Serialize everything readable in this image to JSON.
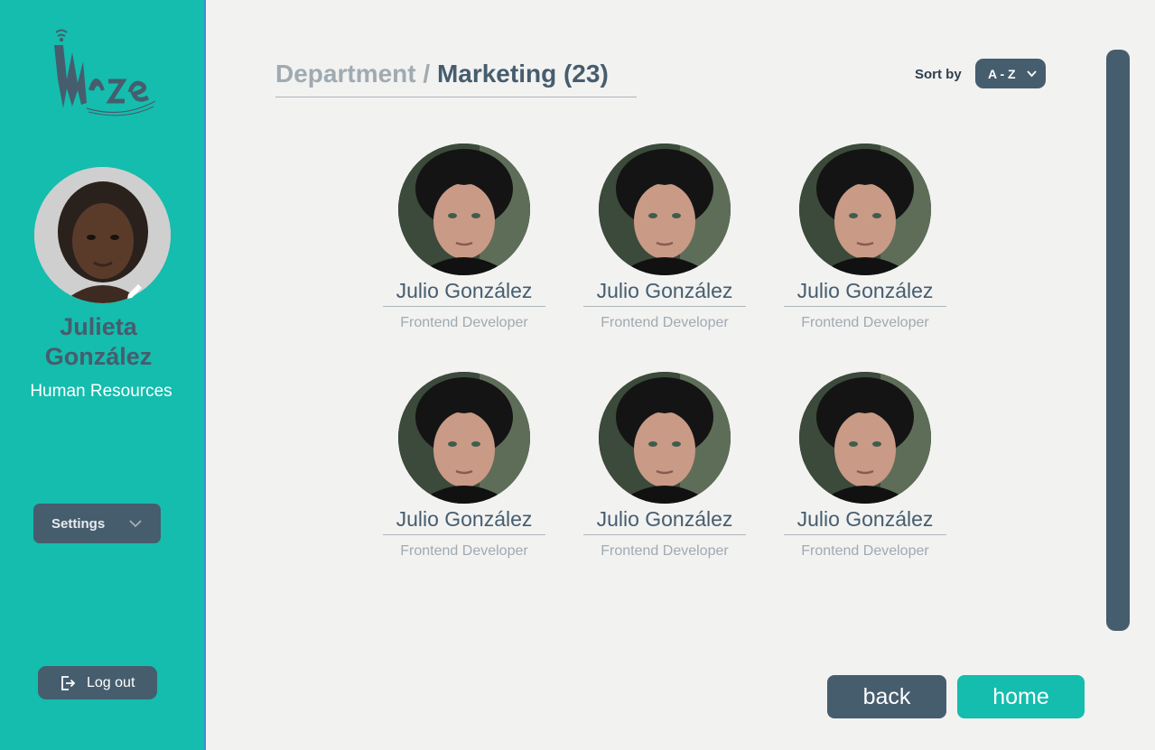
{
  "sidebar": {
    "user": {
      "first_name": "Julieta",
      "last_name": "González",
      "department": "Human Resources"
    },
    "settings_label": "Settings",
    "logout_label": "Log out"
  },
  "header": {
    "breadcrumb_parent": "Department",
    "breadcrumb_separator": "/",
    "current_department": "Marketing",
    "count": "(23)",
    "sort_label": "Sort by",
    "sort_value": "A - Z"
  },
  "employees": [
    {
      "name": "Julio González",
      "role": "Frontend Developer"
    },
    {
      "name": "Julio González",
      "role": "Frontend Developer"
    },
    {
      "name": "Julio González",
      "role": "Frontend Developer"
    },
    {
      "name": "Julio González",
      "role": "Frontend Developer"
    },
    {
      "name": "Julio González",
      "role": "Frontend Developer"
    },
    {
      "name": "Julio González",
      "role": "Frontend Developer"
    }
  ],
  "footer": {
    "back_label": "back",
    "home_label": "home"
  },
  "colors": {
    "sidebar": "#14bdad",
    "primary_dark": "#465d6e",
    "background": "#f2f2f1",
    "muted_text": "#a0aab1"
  }
}
